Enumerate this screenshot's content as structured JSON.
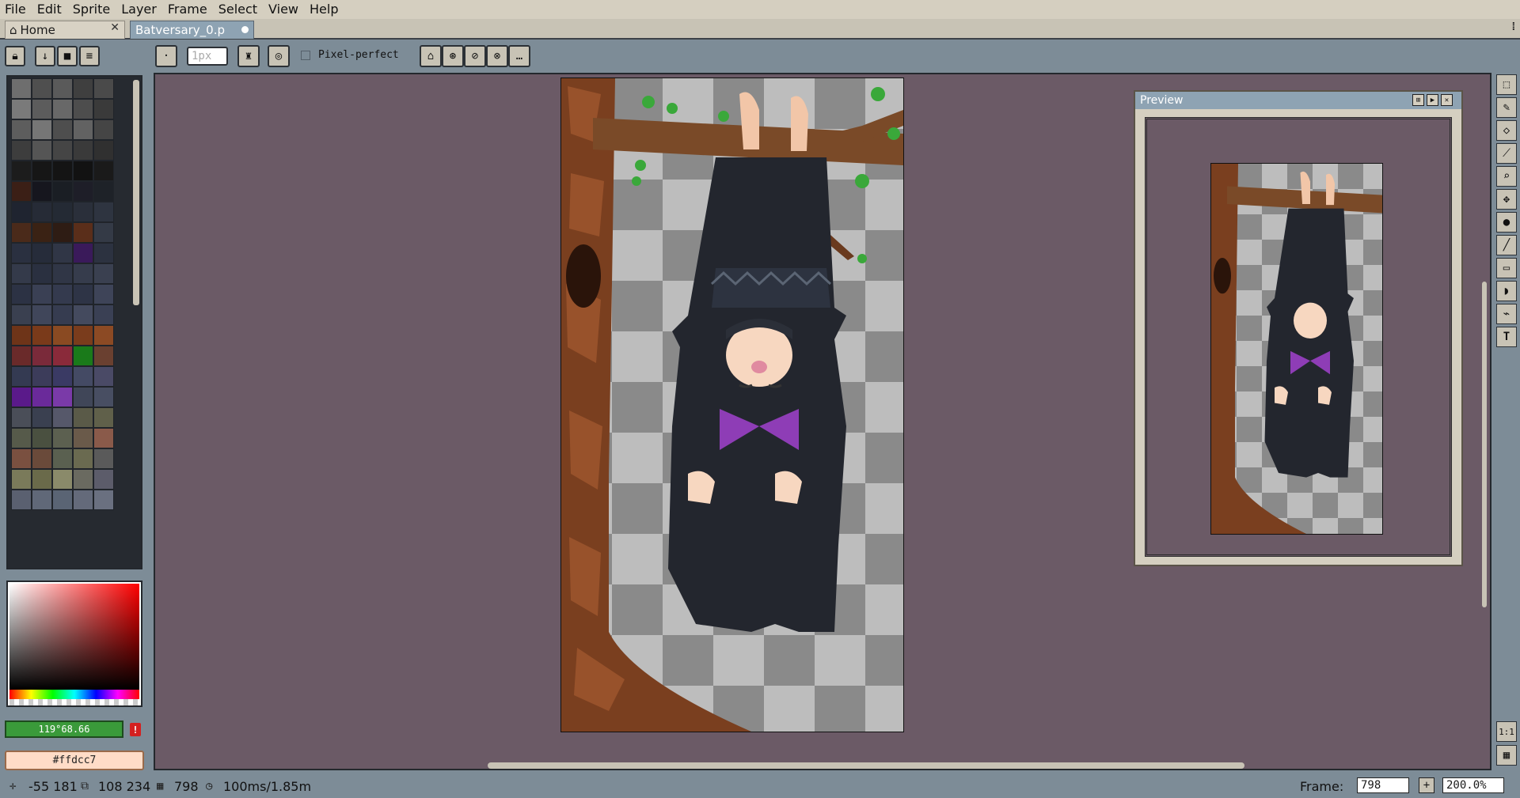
{
  "menu": [
    "File",
    "Edit",
    "Sprite",
    "Layer",
    "Frame",
    "Select",
    "View",
    "Help"
  ],
  "tabs": {
    "home": "Home",
    "file": "Batversary_0.p"
  },
  "toolbar": {
    "brush_size": "1px",
    "pixel_perfect_label": "Pixel-perfect"
  },
  "palette": {
    "colors": [
      "#6e6e6e",
      "#4f4f4f",
      "#5a5a5a",
      "#3f3f3f",
      "#4a4a4a",
      "#7a7a7a",
      "#5c5c5c",
      "#686868",
      "#4d4d4d",
      "#3a3a3a",
      "#5d5d5d",
      "#767676",
      "#4e4e4e",
      "#626262",
      "#454545",
      "#3d3d3d",
      "#555555",
      "#454545",
      "#3a3a3a",
      "#303030",
      "#1c1c1c",
      "#161616",
      "#141414",
      "#121212",
      "#1a1a1a",
      "#3b1f16",
      "#16161e",
      "#1a1e24",
      "#1e1e28",
      "#1e2228",
      "#1f2430",
      "#262b36",
      "#242a34",
      "#2a2f3a",
      "#2e3440",
      "#4a2a1a",
      "#3a2214",
      "#2e1c14",
      "#5a2e1a",
      "#343a46",
      "#2a3040",
      "#262c3a",
      "#303646",
      "#3a1a5a",
      "#2c3240",
      "#343a4a",
      "#2a3040",
      "#303646",
      "#363c4c",
      "#3a4050",
      "#2c3244",
      "#3a4054",
      "#343a4e",
      "#2e3446",
      "#3e4458",
      "#3a4050",
      "#40465a",
      "#363c50",
      "#444a5e",
      "#3a4054",
      "#6e3418",
      "#7a3a1a",
      "#8a4a22",
      "#7a3c1c",
      "#8c4a24",
      "#6a2a2a",
      "#7a2a3a",
      "#8a2a3a",
      "#1a7a1a",
      "#6a4030",
      "#343a52",
      "#3c3c5a",
      "#3a3a64",
      "#444a64",
      "#4a4a66",
      "#5a1a8a",
      "#6a2a9a",
      "#7a3aa8",
      "#404658",
      "#484e62",
      "#4a4e58",
      "#3a4050",
      "#56586a",
      "#5a5a48",
      "#60604a",
      "#565a4a",
      "#4a5040",
      "#5c6050",
      "#6a5a4a",
      "#8a5a4a",
      "#7a5040",
      "#6a4a3a",
      "#5a6050",
      "#6a6a50",
      "#5a5a5a",
      "#7a7a5a",
      "#6a6a4a",
      "#8a8a6a",
      "#6a6a60",
      "#5c5c6a",
      "#5a6070",
      "#606878",
      "#5a6474",
      "#646a7a",
      "#6a7080"
    ]
  },
  "colors": {
    "foreground_text": "119°68.66",
    "foreground_hex": "#3a9a3a",
    "background_text": "#ffdcc7",
    "background_hex": "#ffdcc7"
  },
  "preview": {
    "title": "Preview"
  },
  "status": {
    "cursor": "-55  181",
    "selection": "108  234",
    "frames": "798",
    "duration": "100ms/1.85m",
    "frame_label": "Frame:",
    "frame_value": "798",
    "zoom": "200.0%"
  }
}
